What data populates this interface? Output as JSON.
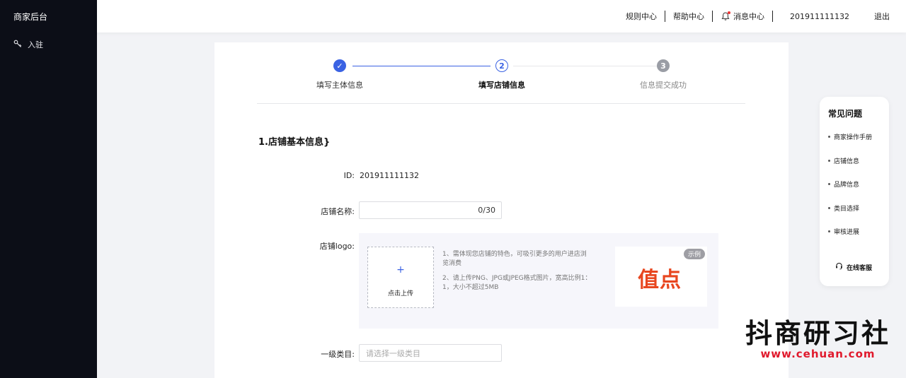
{
  "sidebar": {
    "app_title": "商家后台",
    "nav_items": [
      {
        "label": "入驻",
        "icon": "key-icon"
      }
    ]
  },
  "header": {
    "links": [
      "规则中心",
      "帮助中心",
      "消息中心"
    ],
    "user_id": "201911111132",
    "logout": "退出"
  },
  "steps": [
    {
      "index": "✓",
      "label": "填写主体信息",
      "state": "done"
    },
    {
      "index": "2",
      "label": "填写店铺信息",
      "state": "active"
    },
    {
      "index": "3",
      "label": "信息提交成功",
      "state": "todo"
    }
  ],
  "section": {
    "title": "1.店铺基本信息}"
  },
  "form": {
    "id_label": "ID:",
    "id_value": "201911111132",
    "name_label": "店铺名称:",
    "name_counter": "0/30",
    "logo_label": "店铺logo:",
    "upload_label": "点击上传",
    "upload_plus": "+",
    "tips": [
      "1、需体现您店铺的特色，可吸引更多的用户进店浏览消费",
      "2、请上传PNG、JPG或JPEG格式图片，宽高比例1：1，大小不超过5MB"
    ],
    "sample_badge": "示例",
    "sample_logo_text": "值点",
    "category_label": "一级类目:",
    "category_placeholder": "请选择一级类目"
  },
  "faq": {
    "title": "常见问题",
    "items": [
      "商家操作手册",
      "店铺信息",
      "品牌信息",
      "类目选择",
      "审核进展"
    ],
    "service": "在线客服"
  },
  "watermark": {
    "text": "抖商研习社",
    "url": "www.cehuan.com"
  },
  "colors": {
    "sidebar_bg": "#0c0e17",
    "primary": "#3a62e3",
    "sample_logo": "#e8461f",
    "watermark_url": "#e0192c"
  }
}
